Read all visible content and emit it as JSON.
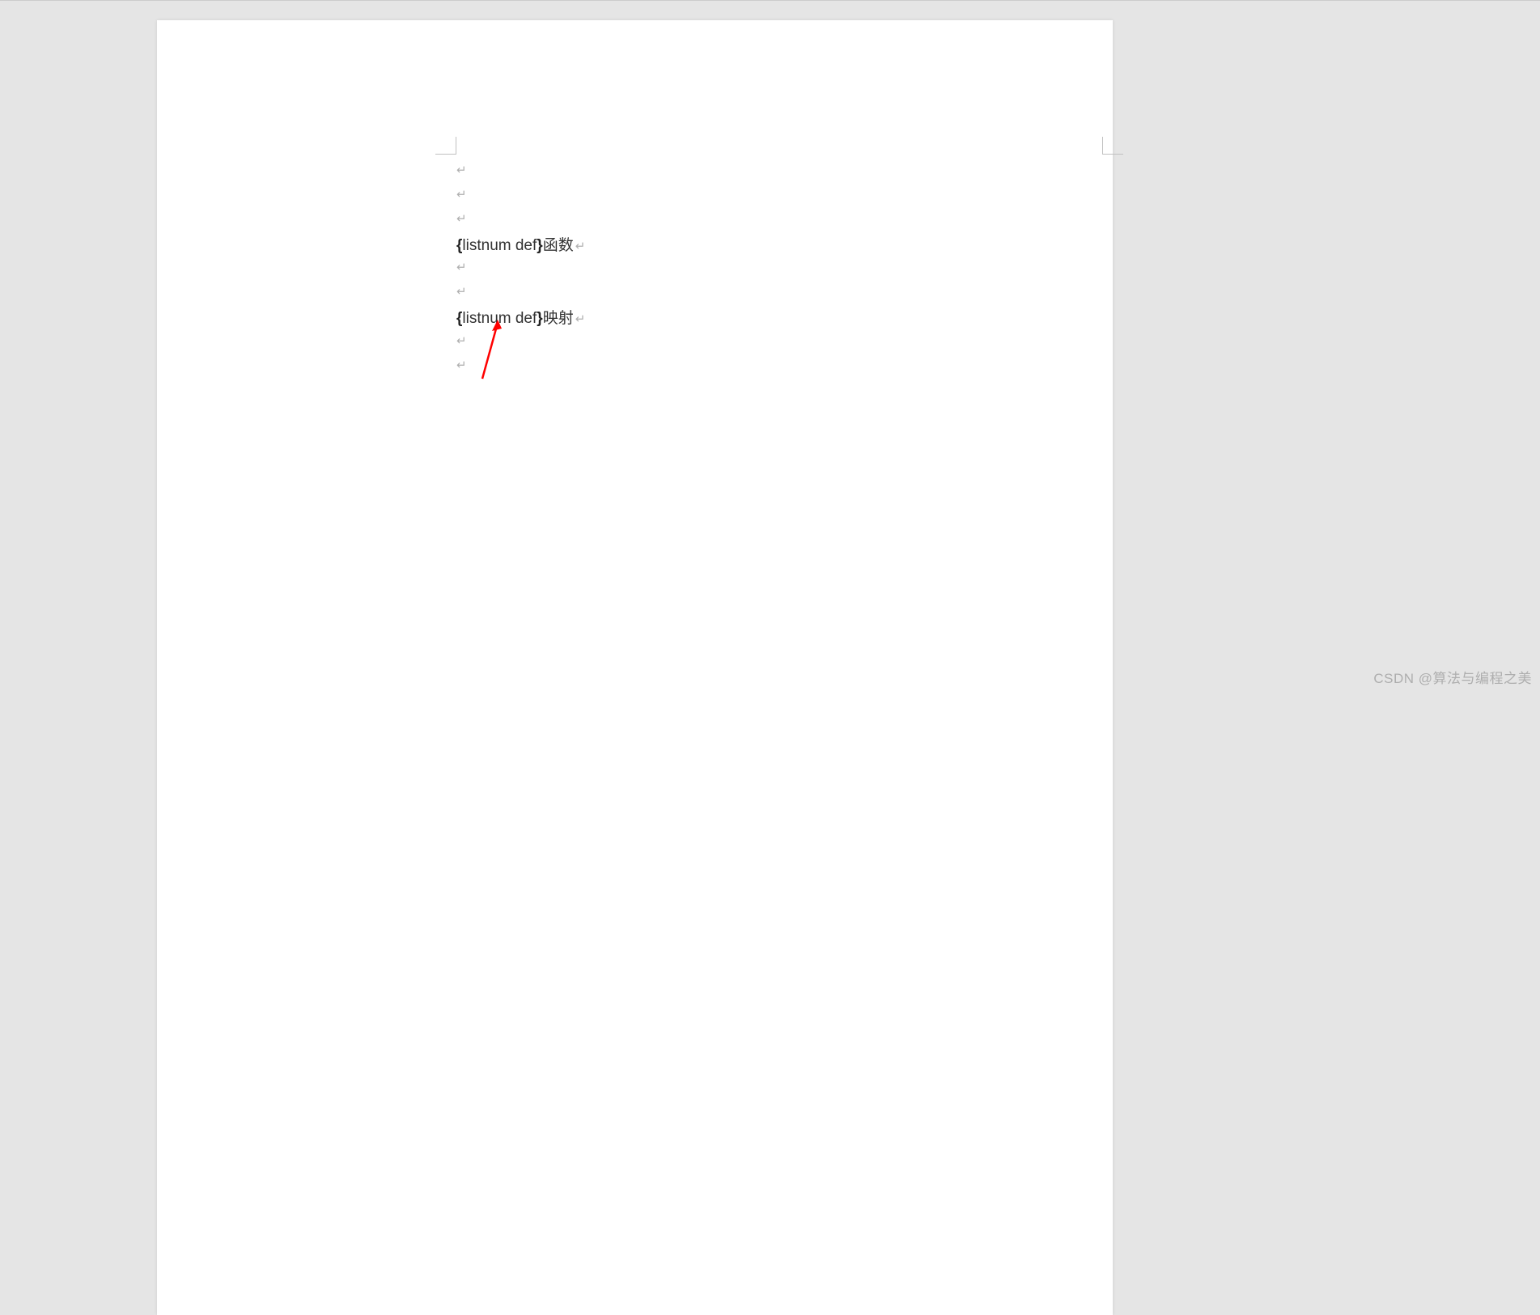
{
  "document": {
    "lines": [
      {
        "type": "empty"
      },
      {
        "type": "empty"
      },
      {
        "type": "empty"
      },
      {
        "type": "field",
        "open": "{",
        "code": " listnum def ",
        "close": "}",
        "text": " 函数"
      },
      {
        "type": "empty"
      },
      {
        "type": "empty"
      },
      {
        "type": "field",
        "open": "{",
        "code": " listnum def ",
        "close": "}",
        "text": " 映射"
      },
      {
        "type": "empty"
      },
      {
        "type": "empty"
      }
    ],
    "paragraph_mark": "↵"
  },
  "annotation": {
    "arrow_color": "#ff0000"
  },
  "watermark": "CSDN @算法与编程之美"
}
